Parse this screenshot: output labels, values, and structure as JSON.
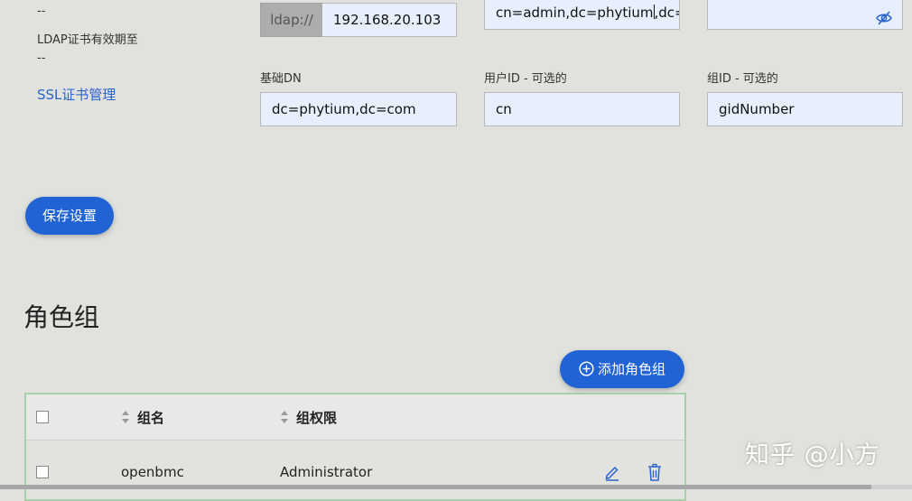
{
  "left_meta": {
    "dash_top": "--",
    "cert_expiry_label": "LDAP证书有效期至",
    "cert_expiry_value": "--",
    "ssl_link": "SSL证书管理"
  },
  "form": {
    "server_prefix": "ldap://",
    "server_value": "192.168.20.103",
    "bind_dn_value_a": "cn=admin,dc=phytium",
    "bind_dn_value_b": ",dc=c",
    "password_value": "",
    "base_dn_label": "基础DN",
    "base_dn_value": "dc=phytium,dc=com",
    "user_id_label": "用户ID - 可选的",
    "user_id_value": "cn",
    "group_id_label": "组ID - 可选的",
    "group_id_value": "gidNumber"
  },
  "save_button": "保存设置",
  "role_groups": {
    "title": "角色组",
    "add_button": "添加角色组",
    "columns": [
      "组名",
      "组权限"
    ],
    "rows": [
      {
        "name": "openbmc",
        "privilege": "Administrator"
      }
    ]
  },
  "watermark": "知乎 @小方",
  "colors": {
    "accent": "#1f63d4",
    "link": "#2a64c9",
    "input_bg": "#e8effc",
    "background": "#e1e1dd"
  },
  "icons": {
    "password_toggle": "eye-slash-icon",
    "add": "plus-circle-icon",
    "edit": "pencil-icon",
    "delete": "trash-icon",
    "sort": "sort-icon"
  }
}
